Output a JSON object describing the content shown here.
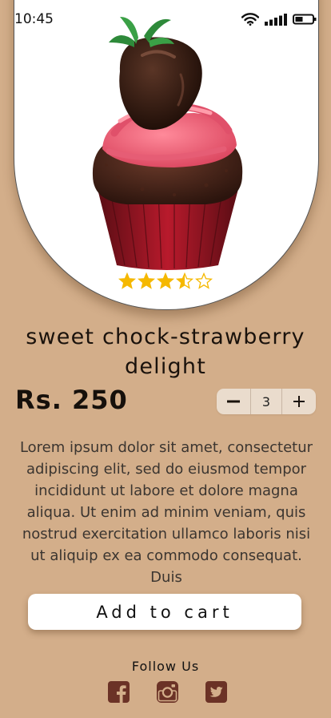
{
  "status_bar": {
    "time": "10:45",
    "icons": [
      "wifi-icon",
      "signal-icon",
      "battery-icon"
    ]
  },
  "product": {
    "image": "chocolate-strawberry-cupcake",
    "rating": 3.5,
    "rating_max": 5,
    "name": "sweet chock-strawberry delight",
    "price": "Rs. 250",
    "quantity": "3",
    "description": "Lorem ipsum dolor sit amet, consectetur adipiscing elit, sed do eiusmod tempor incididunt ut labore et dolore magna aliqua. Ut enim ad minim veniam, quis nostrud exercitation ullamco laboris nisi ut aliquip ex ea commodo consequat. Duis"
  },
  "actions": {
    "add_to_cart": "Add to cart",
    "decrement": "minus-icon",
    "increment": "plus-icon"
  },
  "footer": {
    "follow_label": "Follow Us",
    "social_icons": [
      "facebook-icon",
      "instagram-icon",
      "twitter-icon"
    ]
  },
  "colors": {
    "background": "#d3ae8a",
    "card": "#ffffff",
    "star": "#f5b800",
    "social": "#6b3226",
    "stepper": "#eadccd"
  }
}
